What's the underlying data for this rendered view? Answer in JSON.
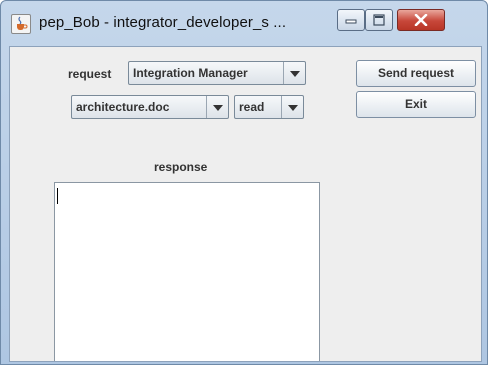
{
  "window": {
    "title": "pep_Bob - integrator_developer_s ...",
    "app_icon": "java-cup-icon",
    "controls": [
      "minimize-icon",
      "maximize-icon",
      "close-icon"
    ]
  },
  "form": {
    "request_label": "request",
    "request_value": "Integration Manager",
    "resource_value": "architecture.doc",
    "action_value": "read",
    "response_label": "response",
    "response_text": ""
  },
  "buttons": {
    "send": "Send request",
    "exit": "Exit"
  },
  "colors": {
    "titlebar": "#b9cfe8",
    "close_button": "#c7473a",
    "panel": "#eeeeee"
  }
}
